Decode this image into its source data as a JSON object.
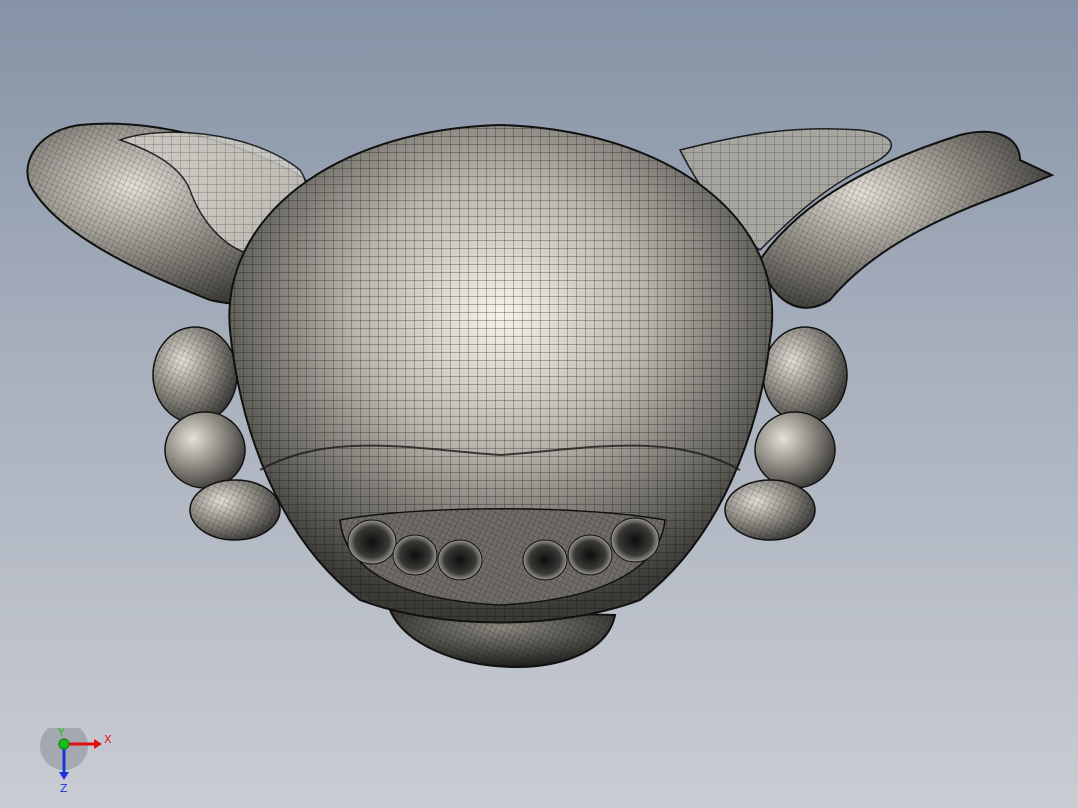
{
  "viewport": {
    "background_top": "#8593a6",
    "background_bottom": "#c9ccd3"
  },
  "model": {
    "render_mode": "shaded-with-mesh-edges",
    "shade_light": "#e9e7df",
    "shade_dark": "#2a2a28",
    "mesh_color": "#111111"
  },
  "triad": {
    "x_label": "X",
    "y_label": "Y",
    "z_label": "Z",
    "x_color": "#e01010",
    "y_color": "#16c016",
    "z_color": "#2036d8"
  }
}
